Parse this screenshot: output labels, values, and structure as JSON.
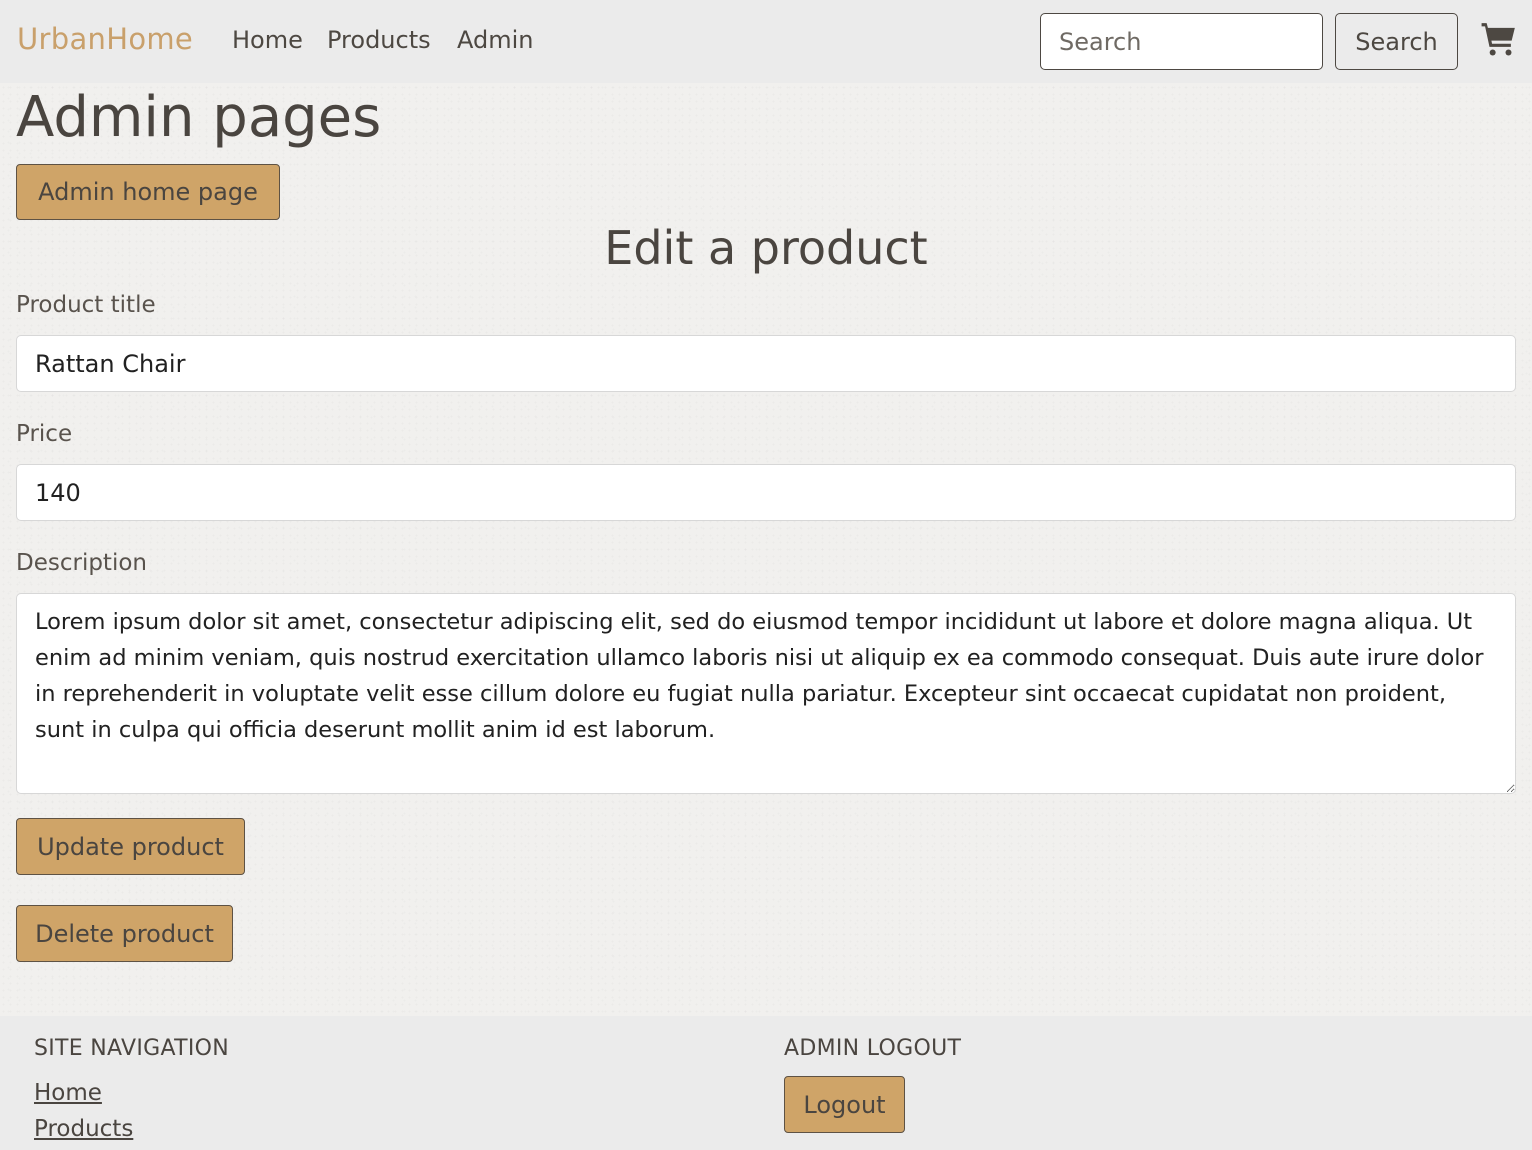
{
  "header": {
    "brand": "UrbanHome",
    "nav": [
      "Home",
      "Products",
      "Admin"
    ],
    "search_placeholder": "Search",
    "search_button": "Search",
    "cart_icon": "cart-icon"
  },
  "main": {
    "page_title": "Admin pages",
    "admin_home_button": "Admin home page",
    "section_title": "Edit a product",
    "product_title_label": "Product title",
    "product_title_value": "Rattan Chair",
    "price_label": "Price",
    "price_value": "140",
    "description_label": "Description",
    "description_value": "Lorem ipsum dolor sit amet, consectetur adipiscing elit, sed do eiusmod tempor incididunt ut labore et dolore magna aliqua. Ut enim ad minim veniam, quis nostrud exercitation ullamco laboris nisi ut aliquip ex ea commodo consequat. Duis aute irure dolor in reprehenderit in voluptate velit esse cillum dolore eu fugiat nulla pariatur. Excepteur sint occaecat cupidatat non proident, sunt in culpa qui officia deserunt mollit anim id est laborum.",
    "update_button": "Update product",
    "delete_button": "Delete product"
  },
  "footer": {
    "site_nav_heading": "SITE NAVIGATION",
    "links": [
      "Home",
      "Products"
    ],
    "admin_logout_heading": "ADMIN LOGOUT",
    "logout_button": "Logout"
  },
  "colors": {
    "accent": "#cfa468",
    "brand": "#c9a06b",
    "text": "#4a4540",
    "bar_background": "#ebebeb"
  }
}
